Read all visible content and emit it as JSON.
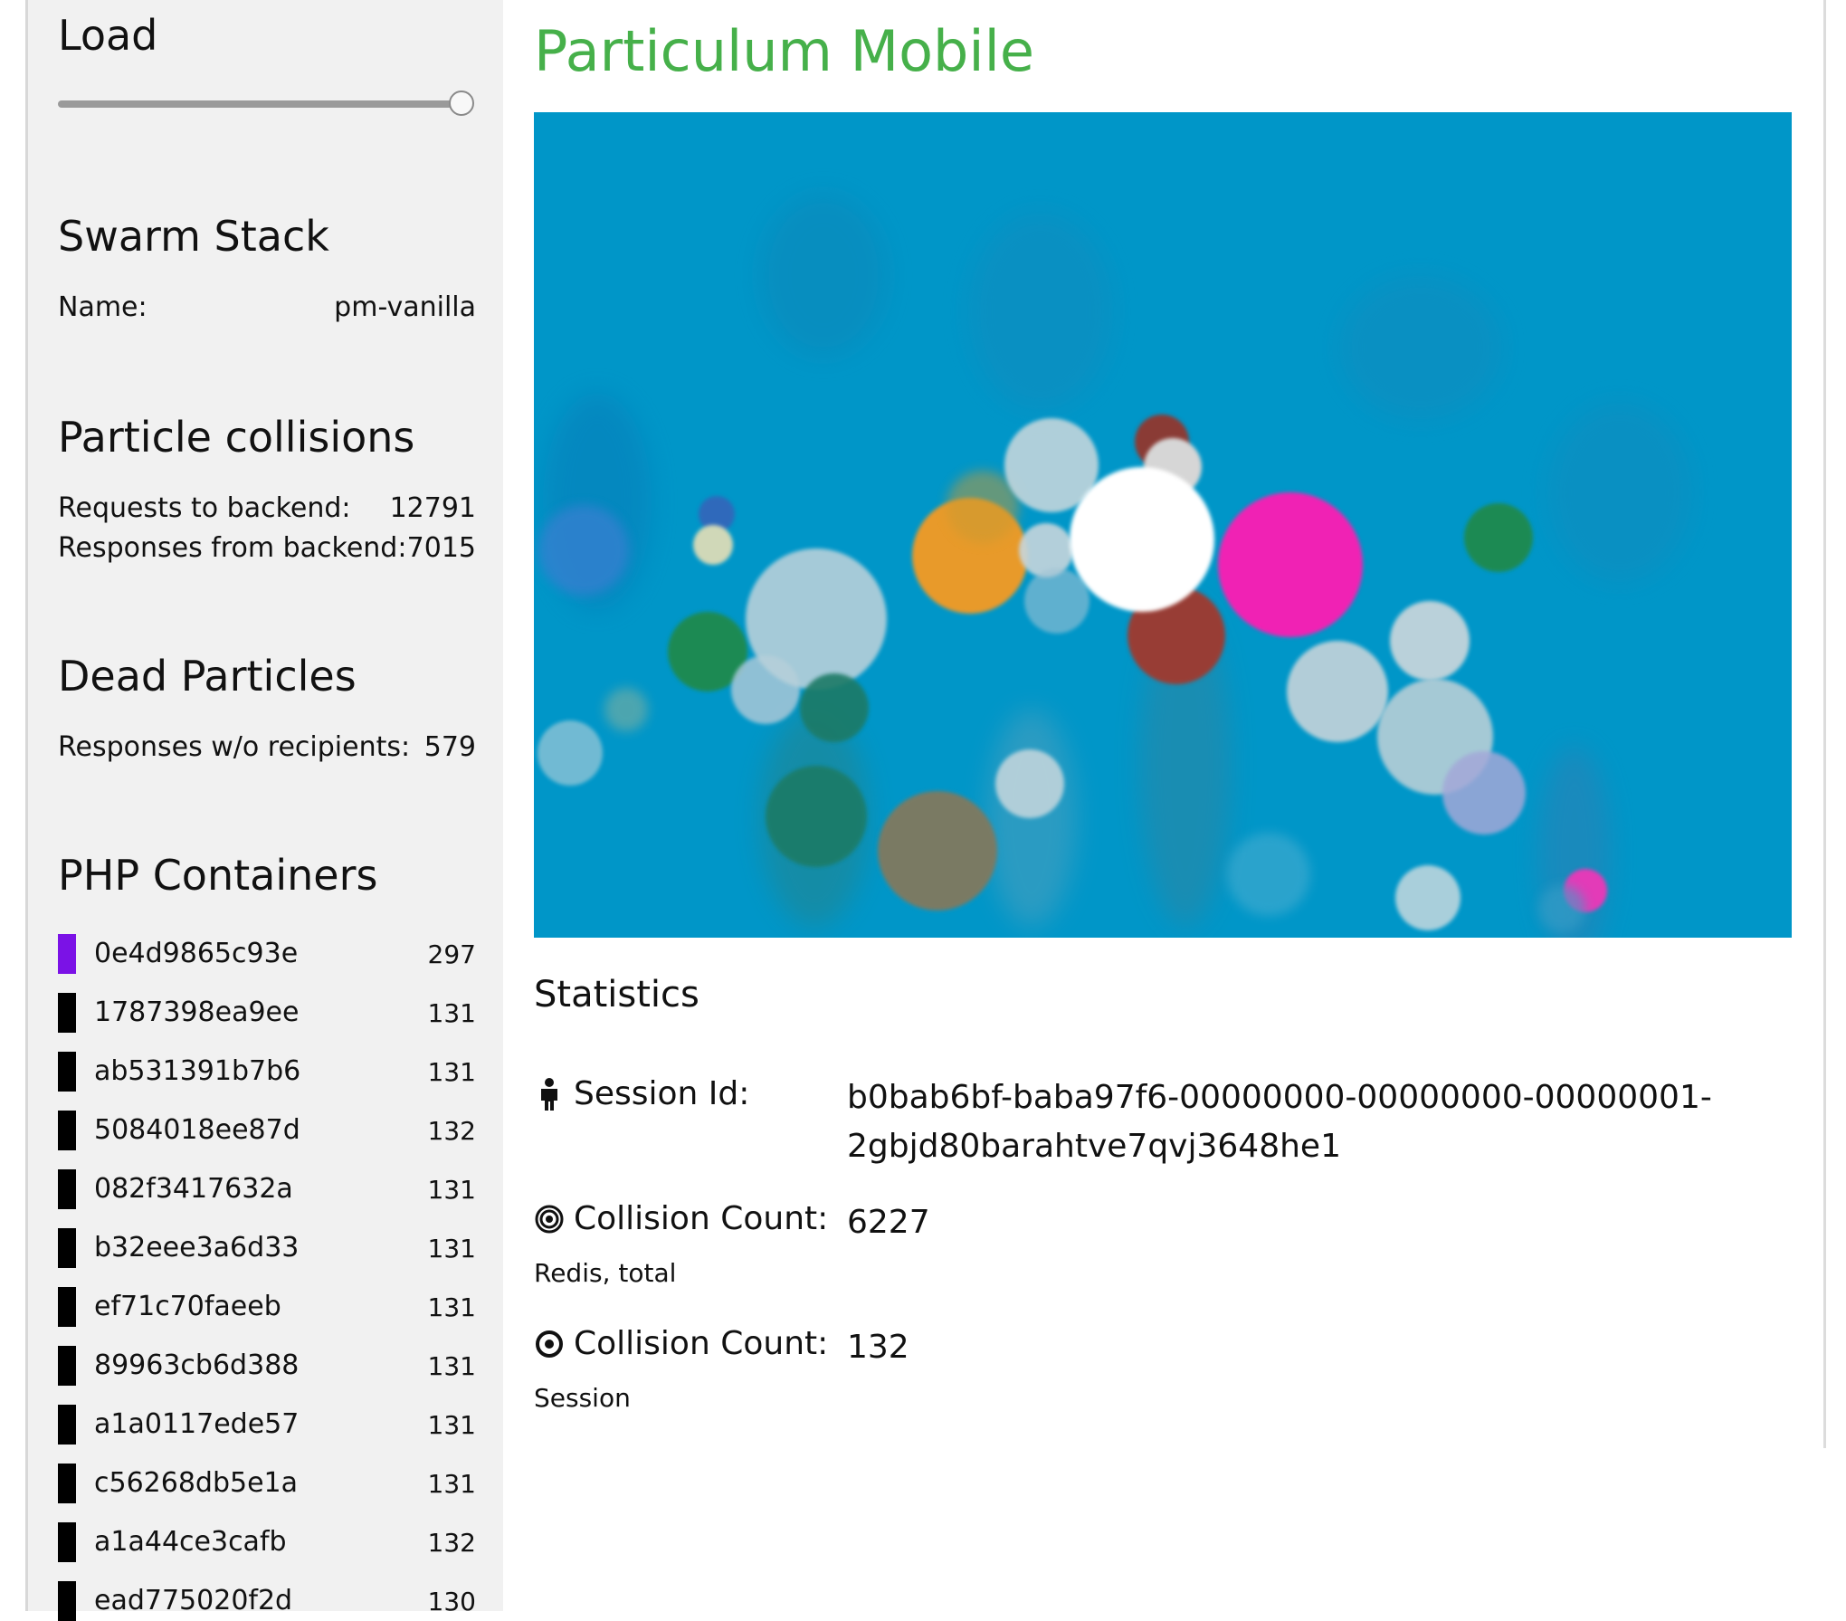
{
  "sidebar": {
    "load": {
      "title": "Load",
      "level": 1.0
    },
    "swarm": {
      "title": "Swarm Stack",
      "name_label": "Name:",
      "name_value": "pm-vanilla"
    },
    "collisions": {
      "title": "Particle collisions",
      "requests_label": "Requests to backend:",
      "requests_value": "12791",
      "responses_label": "Responses from backend:",
      "responses_value": "7015"
    },
    "dead": {
      "title": "Dead Particles",
      "label": "Responses w/o recipients:",
      "value": "579"
    },
    "php": {
      "title": "PHP Containers",
      "containers": [
        {
          "id": "0e4d9865c93e",
          "count": "297",
          "color": "#7b12e6"
        },
        {
          "id": "1787398ea9ee",
          "count": "131",
          "color": "#000000"
        },
        {
          "id": "ab531391b7b6",
          "count": "131",
          "color": "#000000"
        },
        {
          "id": "5084018ee87d",
          "count": "132",
          "color": "#000000"
        },
        {
          "id": "082f3417632a",
          "count": "131",
          "color": "#000000"
        },
        {
          "id": "b32eee3a6d33",
          "count": "131",
          "color": "#000000"
        },
        {
          "id": "ef71c70faeeb",
          "count": "131",
          "color": "#000000"
        },
        {
          "id": "89963cb6d388",
          "count": "131",
          "color": "#000000"
        },
        {
          "id": "a1a0117ede57",
          "count": "131",
          "color": "#000000"
        },
        {
          "id": "c56268db5e1a",
          "count": "131",
          "color": "#000000"
        },
        {
          "id": "a1a44ce3cafb",
          "count": "132",
          "color": "#000000"
        },
        {
          "id": "ead775020f2d",
          "count": "130",
          "color": "#000000"
        }
      ]
    }
  },
  "main": {
    "title": "Particulum Mobile",
    "canvas_bg": "#0096c8",
    "statistics": {
      "title": "Statistics",
      "session_label": "Session Id:",
      "session_value": "b0bab6bf-baba97f6-00000000-00000000-00000001-2gbjd80barahtve7qvj3648he1",
      "collision_total_label": "Collision Count:",
      "collision_total_value": "6227",
      "collision_total_sub": "Redis, total",
      "collision_session_label": "Collision Count:",
      "collision_session_value": "132",
      "collision_session_sub": "Session"
    }
  },
  "icons": {
    "session": "person-icon",
    "total": "target-rings-icon",
    "session_count": "target-dot-icon"
  },
  "colors": {
    "title_green": "#46b04a",
    "canvas_blue": "#0096c8",
    "highlight_swatch": "#7b12e6"
  }
}
